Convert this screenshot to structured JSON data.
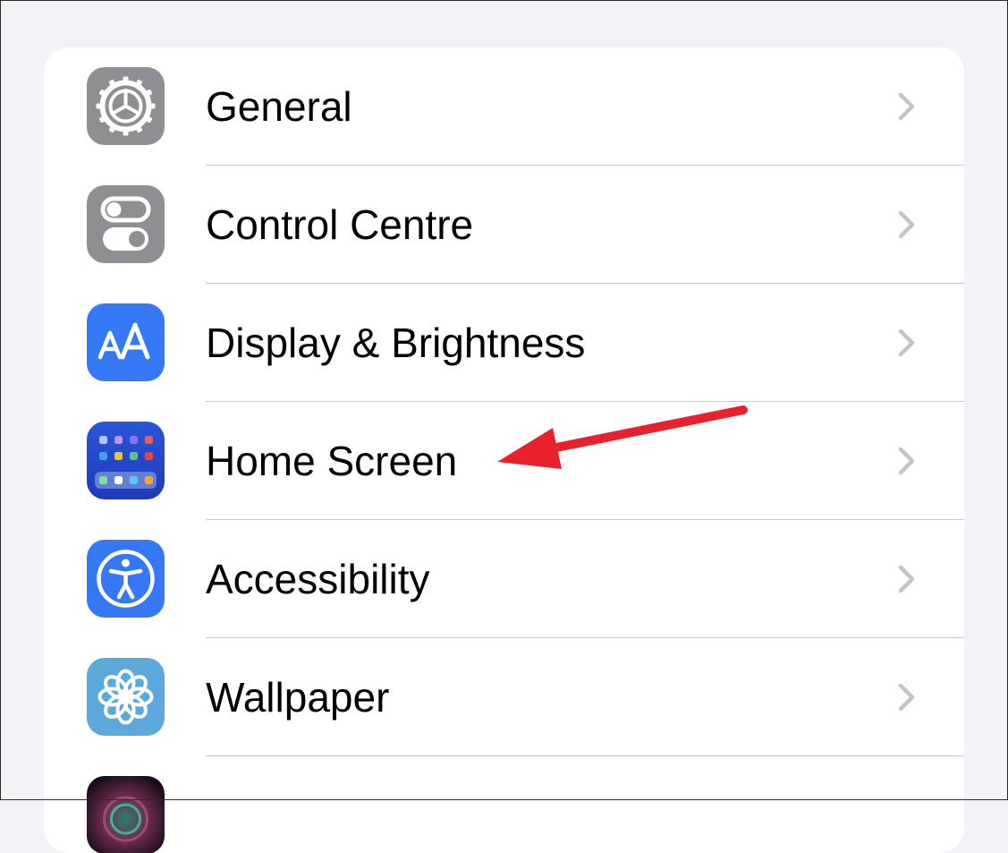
{
  "settings": {
    "items": [
      {
        "label": "General",
        "icon": "gear-icon"
      },
      {
        "label": "Control Centre",
        "icon": "toggles-icon"
      },
      {
        "label": "Display & Brightness",
        "icon": "text-size-icon"
      },
      {
        "label": "Home Screen",
        "icon": "home-screen-grid-icon"
      },
      {
        "label": "Accessibility",
        "icon": "accessibility-person-icon"
      },
      {
        "label": "Wallpaper",
        "icon": "flower-icon"
      },
      {
        "label": "",
        "icon": "siri-icon"
      }
    ]
  },
  "colors": {
    "background": "#f2f2f7",
    "group": "#ffffff",
    "icon_gray": "#8e8e93",
    "icon_blue": "#3478f6",
    "icon_home_bg": "#2146c7",
    "icon_wallpaper": "#5aa9da",
    "arrow_red": "#e8212a",
    "chevron": "#c4c4c7"
  }
}
